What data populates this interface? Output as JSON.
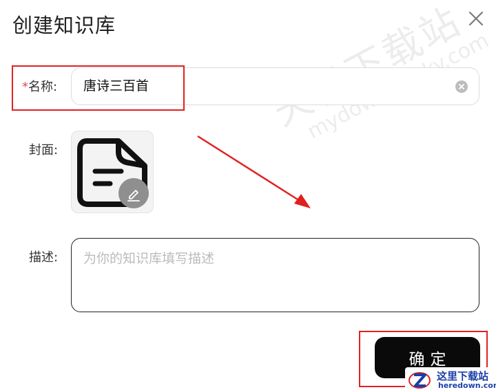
{
  "dialog": {
    "title": "创建知识库",
    "close_icon": "close-icon"
  },
  "form": {
    "name": {
      "required_mark": "*",
      "label": "名称:",
      "value": "唐诗三百首",
      "clear_icon": "clear-circle-icon"
    },
    "cover": {
      "label": "封面:",
      "image_icon": "document-icon",
      "edit_icon": "pencil-icon"
    },
    "description": {
      "label": "描述:",
      "value": "",
      "placeholder": "为你的知识库填写描述"
    },
    "confirm_label": "确定"
  },
  "watermark": {
    "text": "天极下载站",
    "url": "mydown.yesky.com"
  },
  "badge": {
    "name": "这里下载站",
    "url": "heredown.com"
  },
  "colors": {
    "annotation_red": "#e02020",
    "required_red": "#e5484d",
    "button_black": "#0a0a0a",
    "badge_blue": "#1b3fa8"
  }
}
